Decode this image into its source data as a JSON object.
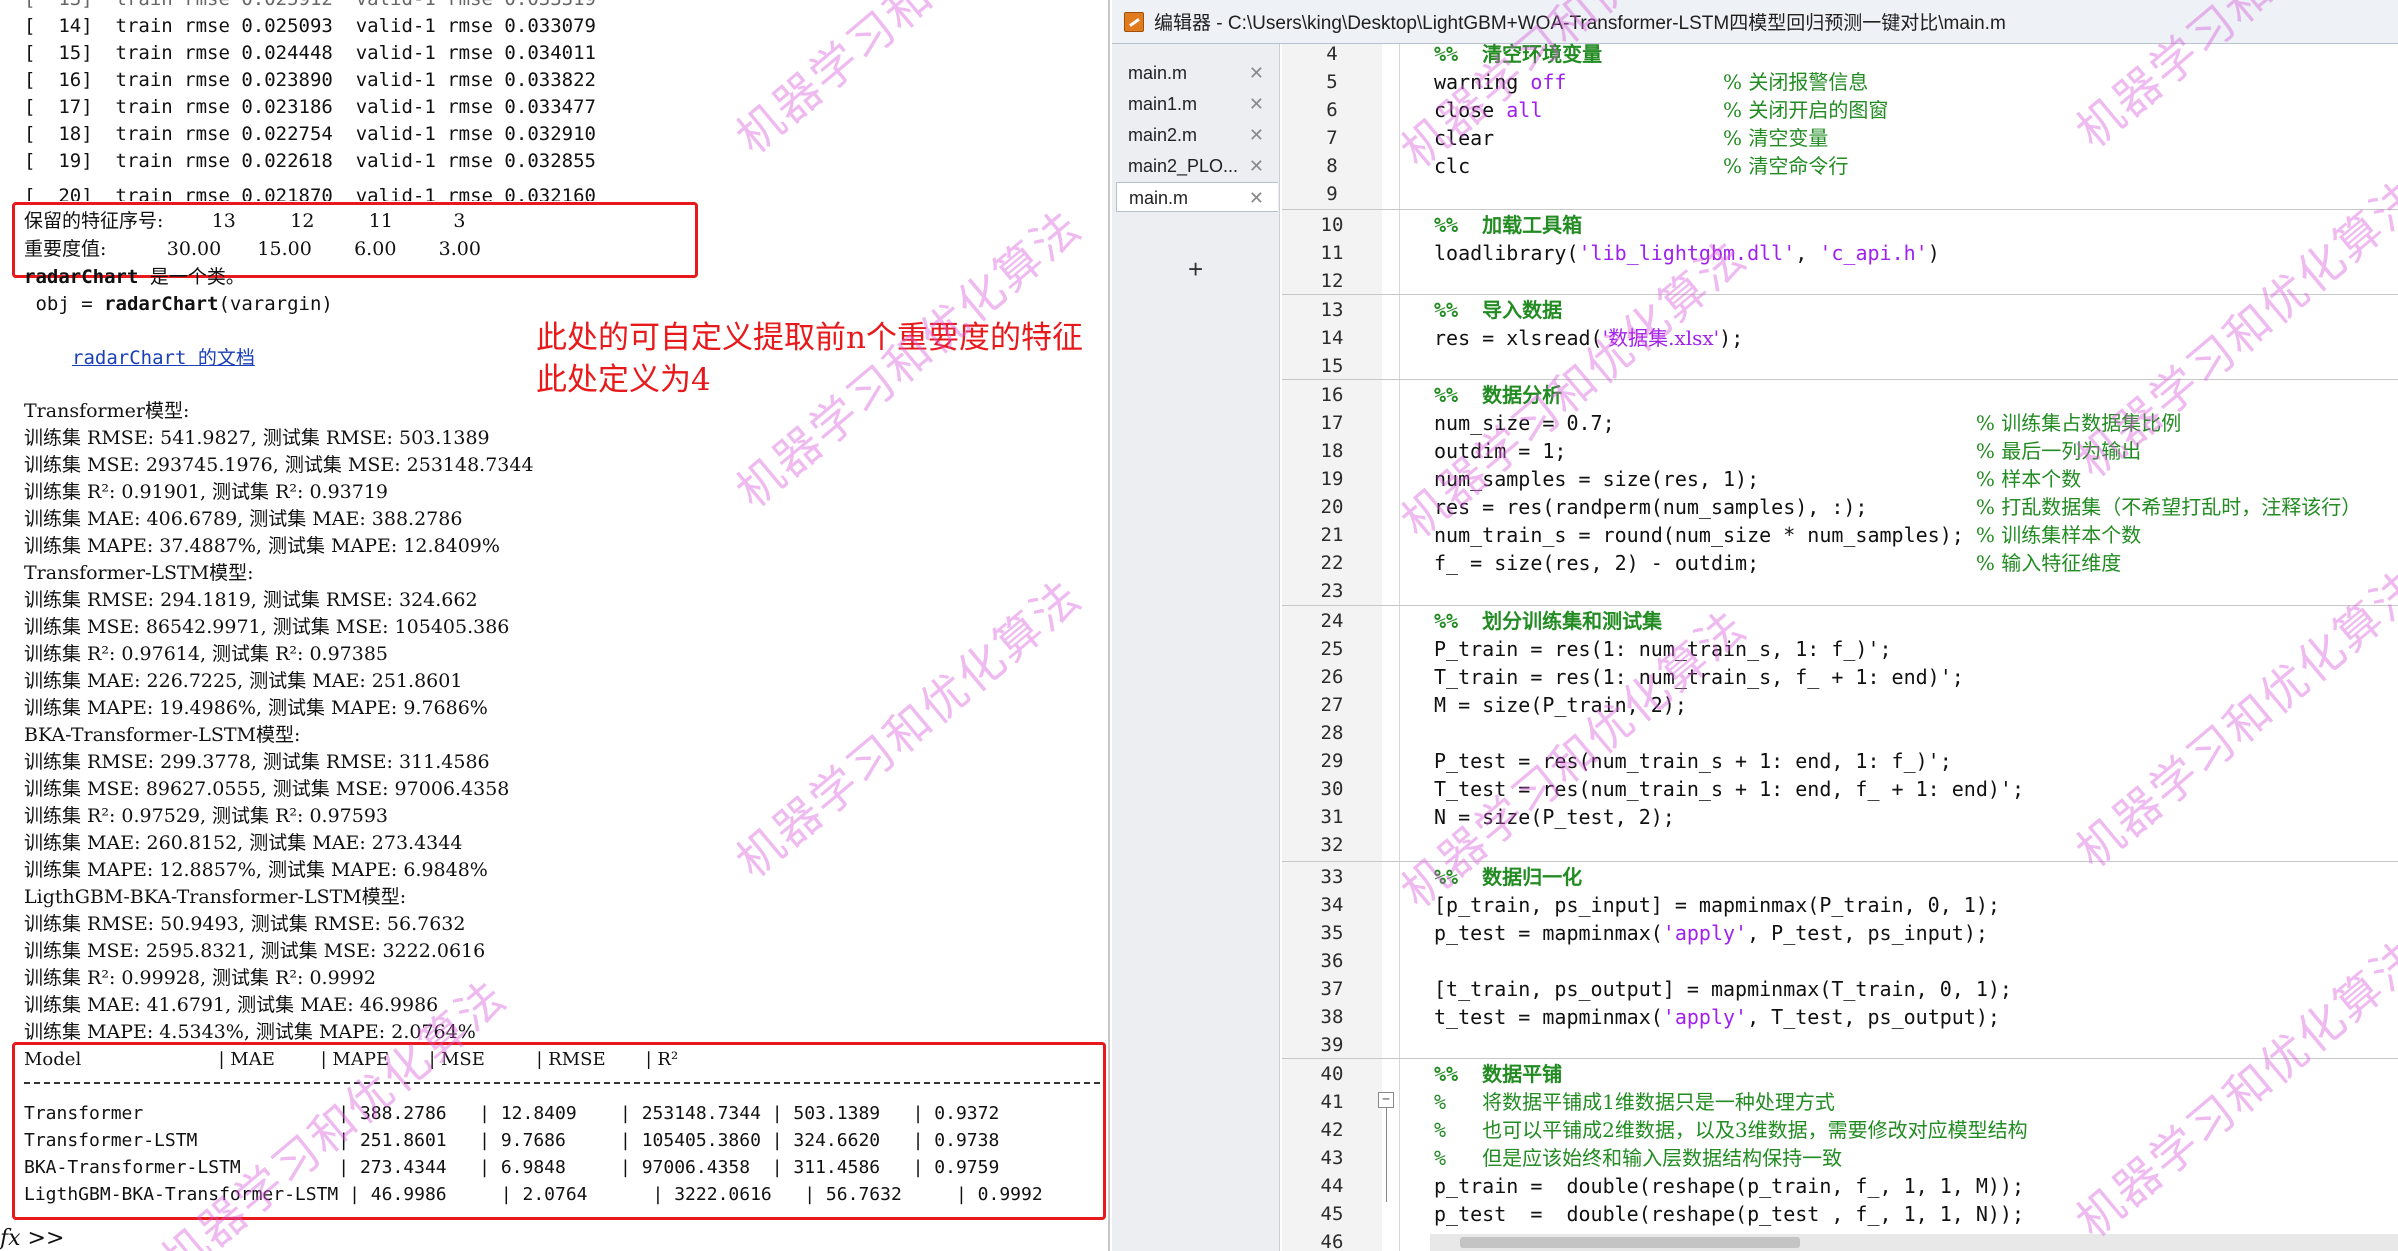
{
  "command_window": {
    "train_lines": [
      "[  14]  train rmse 0.025093  valid-1 rmse 0.033079",
      "[  15]  train rmse 0.024448  valid-1 rmse 0.034011",
      "[  16]  train rmse 0.023890  valid-1 rmse 0.033822",
      "[  17]  train rmse 0.023186  valid-1 rmse 0.033477",
      "[  18]  train rmse 0.022754  valid-1 rmse 0.032910",
      "[  19]  train rmse 0.022618  valid-1 rmse 0.032855",
      "[  20]  train rmse 0.021870  valid-1 rmse 0.032160"
    ],
    "feature_line": "保留的特征序号:        13         12         11          3",
    "importance_line": "重要度值:          30.00      15.00       6.00       3.00",
    "radar_line_prefix": "radarChart",
    "radar_line_suffix": " 是一个类。",
    "obj_line_prefix": " obj = ",
    "obj_line_fn": "radarChart",
    "obj_line_suffix": "(varargin)",
    "doc_link": "radarChart 的文档",
    "annotation_line1": "此处的可自定义提取前n个重要度的特征",
    "annotation_line2": "此处定义为4",
    "metrics_lines": [
      "Transformer模型:",
      "训练集 RMSE: 541.9827, 测试集 RMSE: 503.1389",
      "训练集 MSE: 293745.1976, 测试集 MSE: 253148.7344",
      "训练集 R²: 0.91901, 测试集 R²: 0.93719",
      "训练集 MAE: 406.6789, 测试集 MAE: 388.2786",
      "训练集 MAPE: 37.4887%, 测试集 MAPE: 12.8409%",
      "Transformer-LSTM模型:",
      "训练集 RMSE: 294.1819, 测试集 RMSE: 324.662",
      "训练集 MSE: 86542.9971, 测试集 MSE: 105405.386",
      "训练集 R²: 0.97614, 测试集 R²: 0.97385",
      "训练集 MAE: 226.7225, 测试集 MAE: 251.8601",
      "训练集 MAPE: 19.4986%, 测试集 MAPE: 9.7686%",
      "BKA-Transformer-LSTM模型:",
      "训练集 RMSE: 299.3778, 测试集 RMSE: 311.4586",
      "训练集 MSE: 89627.0555, 测试集 MSE: 97006.4358",
      "训练集 R²: 0.97529, 测试集 R²: 0.97593",
      "训练集 MAE: 260.8152, 测试集 MAE: 273.4344",
      "训练集 MAPE: 12.8857%, 测试集 MAPE: 6.9848%",
      "LigthGBM-BKA-Transformer-LSTM模型:",
      "训练集 RMSE: 50.9493, 测试集 RMSE: 56.7632",
      "训练集 MSE: 2595.8321, 测试集 MSE: 3222.0616",
      "训练集 R²: 0.99928, 测试集 R²: 0.9992",
      "训练集 MAE: 41.6791, 测试集 MAE: 46.9986",
      "训练集 MAPE: 4.5343%, 测试集 MAPE: 2.0764%"
    ],
    "table_header": "Model                        | MAE        | MAPE       | MSE         | RMSE       | R²",
    "table_rows": [
      "Transformer                  | 388.2786   | 12.8409    | 253148.7344 | 503.1389   | 0.9372",
      "Transformer-LSTM             | 251.8601   | 9.7686     | 105405.3860 | 324.6620   | 0.9738",
      "BKA-Transformer-LSTM         | 273.4344   | 6.9848     | 97006.4358  | 311.4586   | 0.9759",
      "LigthGBM-BKA-Transformer-LSTM | 46.9986     | 2.0764      | 3222.0616   | 56.7632     | 0.9992"
    ],
    "prompt": "fx >>"
  },
  "editor": {
    "title": "编辑器 - C:\\Users\\king\\Desktop\\LightGBM+WOA-Transformer-LSTM四模型回归预测一键对比\\main.m",
    "tabs": [
      "main.m",
      "main1.m",
      "main2.m",
      "main2_PLO...",
      "main.m"
    ],
    "close_glyph": "✕",
    "add_glyph": "+",
    "fold_glyph": "−",
    "line_numbers": [
      "4",
      "5",
      "6",
      "7",
      "8",
      "9",
      "10",
      "11",
      "12",
      "13",
      "14",
      "15",
      "16",
      "17",
      "18",
      "19",
      "20",
      "21",
      "22",
      "23",
      "24",
      "25",
      "26",
      "27",
      "28",
      "29",
      "30",
      "31",
      "32",
      "33",
      "34",
      "35",
      "36",
      "37",
      "38",
      "39",
      "40",
      "41",
      "42",
      "43",
      "44",
      "45",
      "46"
    ],
    "lines": {
      "l4_a": "%%  ",
      "l4_b": "清空环境变量",
      "l5_a": "warning ",
      "l5_kw": "off",
      "l5_pad": "             ",
      "l5_cm": "% 关闭报警信息",
      "l6_a": "close ",
      "l6_kw": "all",
      "l6_pad": "               ",
      "l6_cm": "% 关闭开启的图窗",
      "l7_a": "clear",
      "l7_pad": "                   ",
      "l7_cm": "% 清空变量",
      "l8_a": "clc",
      "l8_pad": "                     ",
      "l8_cm": "% 清空命令行",
      "l10_a": "%%  ",
      "l10_b": "加载工具箱",
      "l11_a": "loadlibrary(",
      "l11_s1": "'lib_lightgbm.dll'",
      "l11_b": ", ",
      "l11_s2": "'c_api.h'",
      "l11_c": ")",
      "l13_a": "%%  ",
      "l13_b": "导入数据",
      "l14_a": "res = xlsread(",
      "l14_s": "'数据集.xlsx'",
      "l14_c": ");",
      "l16_a": "%%  ",
      "l16_b": "数据分析",
      "l17_a": "num_size = 0.7;",
      "l17_pad": "                              ",
      "l17_cm": "% 训练集占数据集比例",
      "l18_a": "outdim = 1;",
      "l18_pad": "                                  ",
      "l18_cm": "% 最后一列为输出",
      "l19_a": "num_samples = size(res, 1);",
      "l19_pad": "                  ",
      "l19_cm": "% 样本个数",
      "l20_a": "res = res(randperm(num_samples), :);",
      "l20_pad": "         ",
      "l20_cm": "% 打乱数据集（不希望打乱时，注释该行）",
      "l21_a": "num_train_s = round(num_size * num_samples);",
      "l21_pad": " ",
      "l21_cm": "% 训练集样本个数",
      "l22_a": "f_ = size(res, 2) - outdim;",
      "l22_pad": "                  ",
      "l22_cm": "% 输入特征维度",
      "l24_a": "%%  ",
      "l24_b": "划分训练集和测试集",
      "l25_a": "P_train = res(1: num_train_s, 1: f_)';",
      "l26_a": "T_train = res(1: num_train_s, f_ + 1: end)';",
      "l27_a": "M = size(P_train, 2);",
      "l29_a": "P_test = res(num_train_s + 1: end, 1: f_)';",
      "l30_a": "T_test = res(num_train_s + 1: end, f_ + 1: end)';",
      "l31_a": "N = size(P_test, 2);",
      "l33_a": "%%  ",
      "l33_b": "数据归一化",
      "l34_a": "[p_train, ps_input] = mapminmax(P_train, 0, 1);",
      "l35_a": "p_test = mapminmax(",
      "l35_s": "'apply'",
      "l35_c": ", P_test, ps_input);",
      "l37_a": "[t_train, ps_output] = mapminmax(T_train, 0, 1);",
      "l38_a": "t_test = mapminmax(",
      "l38_s": "'apply'",
      "l38_c": ", T_test, ps_output);",
      "l40_a": "%%  ",
      "l40_b": "数据平铺",
      "l41_a": "%   ",
      "l41_b": "将数据平铺成1维数据只是一种处理方式",
      "l42_a": "%   ",
      "l42_b": "也可以平铺成2维数据，以及3维数据，需要修改对应模型结构",
      "l43_a": "%   ",
      "l43_b": "但是应该始终和输入层数据结构保持一致",
      "l44_a": "p_train =  double(reshape(p_train, f_, 1, 1, M));",
      "l45_a": "p_test  =  double(reshape(p_test , f_, 1, 1, N));"
    }
  },
  "watermark": "机器学习和优化算法",
  "colors": {
    "annotation_red": "#e8191b",
    "keyword_blue": "#0000ff",
    "string_purple": "#a020f0",
    "comment_green": "#228b22",
    "watermark_pink": "#d65adc"
  }
}
